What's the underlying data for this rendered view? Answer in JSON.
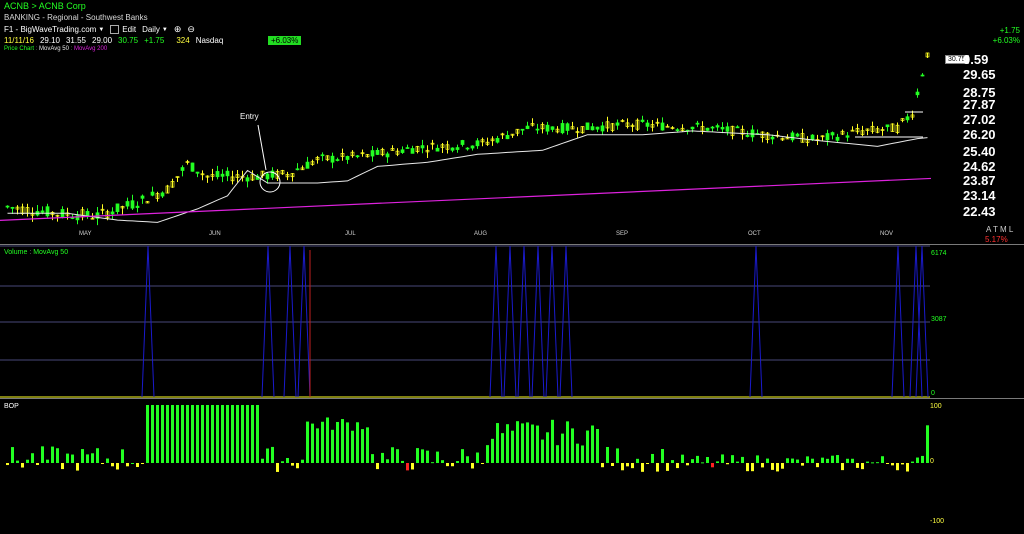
{
  "header": {
    "symbol_line": "ACNB > ACNB Corp",
    "industry_line": "BANKING - Regional - Southwest Banks"
  },
  "toolbar": {
    "layout_name": "F1 - BigWaveTrading.com",
    "edit_label": "Edit",
    "period_label": "Daily"
  },
  "quote": {
    "date": "11/11/16",
    "open": "29.10",
    "high": "31.55",
    "low": "29.00",
    "close": "30.75",
    "change": "+1.75",
    "volume": "324",
    "exchange": "Nasdaq",
    "pct_badge": "+6.03%"
  },
  "top_right": {
    "change": "+1.75",
    "pct": "+6.03%"
  },
  "legend": {
    "price_chart": "Price Chart",
    "ma50": "MovAvg 50",
    "ma200": "MovAvg 200",
    "volume_pane": "Volume",
    "volume_ma": "MovAvg 50",
    "bop_pane": "BOP"
  },
  "colors": {
    "up": "#22ff22",
    "down": "#ffff22",
    "ma50": "#e8e8e8",
    "ma200": "#dd22dd",
    "volume": "#1a1acc",
    "bop_pos": "#22ff22",
    "bop_neg": "#ffff22",
    "bop_red": "#ff2222"
  },
  "price_axis": {
    "current_price_tag": "30.75",
    "labels": [
      "0.59",
      "29.65",
      "28.75",
      "27.87",
      "27.02",
      "26.20",
      "25.40",
      "24.62",
      "23.87",
      "23.14",
      "22.43"
    ]
  },
  "right_markers": {
    "atml": "A T M L",
    "pct": "5.17%"
  },
  "annotation": {
    "entry_label": "Entry"
  },
  "months": [
    "MAY",
    "JUN",
    "JUL",
    "AUG",
    "SEP",
    "OCT",
    "NOV"
  ],
  "volume_axis": [
    "6174",
    "3087",
    "0"
  ],
  "bop_axis": [
    "100",
    "0",
    "-100"
  ],
  "chart_data": {
    "type": "candlestick",
    "note_axis_scale": "log",
    "price_ylim": [
      22.0,
      31.6
    ],
    "price_series": [
      {
        "x": "MAY",
        "close": 22.7
      },
      {
        "x": "MAY",
        "close": 22.6
      },
      {
        "x": "MAY",
        "close": 22.5
      },
      {
        "x": "MAY",
        "close": 22.8
      },
      {
        "x": "JUN",
        "close": 23.2
      },
      {
        "x": "JUN",
        "close": 24.4
      },
      {
        "x": "JUN",
        "close": 24.3
      },
      {
        "x": "JUN",
        "close": 24.1
      },
      {
        "x": "JUL",
        "close": 24.8
      },
      {
        "x": "JUL",
        "close": 25.1
      },
      {
        "x": "JUL",
        "close": 25.3
      },
      {
        "x": "AUG",
        "close": 25.4
      },
      {
        "x": "AUG",
        "close": 26.3
      },
      {
        "x": "AUG",
        "close": 26.6
      },
      {
        "x": "SEP",
        "close": 26.5
      },
      {
        "x": "SEP",
        "close": 26.6
      },
      {
        "x": "SEP",
        "close": 26.5
      },
      {
        "x": "OCT",
        "close": 26.3
      },
      {
        "x": "OCT",
        "close": 26.0
      },
      {
        "x": "OCT",
        "close": 25.8
      },
      {
        "x": "NOV",
        "close": 26.5
      },
      {
        "x": "NOV",
        "close": 27.6
      },
      {
        "x": "NOV",
        "close": 30.75
      }
    ],
    "volume_ylim": [
      0,
      6174
    ],
    "bop_ylim": [
      -100,
      100
    ]
  }
}
